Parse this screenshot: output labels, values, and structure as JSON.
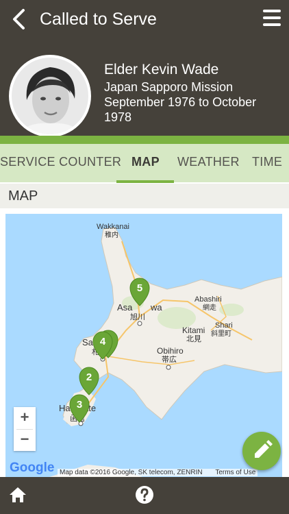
{
  "header": {
    "title": "Called to Serve",
    "back_icon": "chevron-left-icon",
    "menu_icon": "hamburger-menu-icon"
  },
  "profile": {
    "name": "Elder Kevin Wade",
    "mission": "Japan Sapporo Mission",
    "dates_line1": "September 1976 to October",
    "dates_line2": "1978"
  },
  "tabs": [
    {
      "label": "SERVICE COUNTER",
      "active": false
    },
    {
      "label": "MAP",
      "active": true
    },
    {
      "label": "WEATHER",
      "active": false
    },
    {
      "label": "TIME",
      "active": false
    }
  ],
  "section_title": "MAP",
  "map": {
    "labels": {
      "wakkanai": "Wakkanai",
      "wakkanai_jp": "稚内",
      "asahikawa_a": "Asa",
      "asahikawa_b": "wa",
      "asahikawa_jp": "旭川",
      "abashiri": "Abashiri",
      "abashiri_jp": "網走",
      "shari": "Shari",
      "shari_jp": "斜里町",
      "kitami": "Kitami",
      "kitami_jp": "北見",
      "sapporo_a": "Sa",
      "sapporo_b": "ro",
      "sapporo_jp": "札幌",
      "obihiro": "Obihiro",
      "obihiro_jp": "帯広",
      "hakodate_a": "Ha",
      "hakodate_b": "ate",
      "hakodate_jp": "函館"
    },
    "markers": [
      "1",
      "2",
      "3",
      "4",
      "5"
    ],
    "zoom_in": "+",
    "zoom_out": "−",
    "google": "Google",
    "attribution": "Map data ©2016 Google, SK telecom, ZENRIN",
    "terms": "Terms of Use"
  },
  "fab_icon": "pencil-icon",
  "bottom": {
    "home_icon": "home-icon",
    "help_icon": "help-circle-icon"
  },
  "colors": {
    "dark": "#45413a",
    "accent": "#7cb342",
    "tab_bg": "#d6e8c4",
    "water": "#aadaff",
    "land": "#f2efe9"
  }
}
